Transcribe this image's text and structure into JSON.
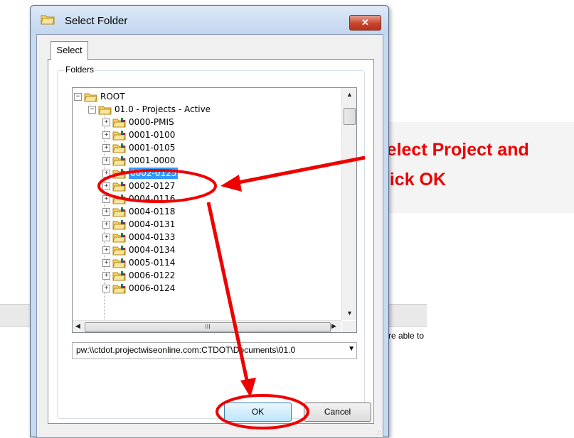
{
  "background": {
    "partial_text": "re able to"
  },
  "callout": {
    "text": "Select Project and\nclick OK",
    "color": "#ee0000"
  },
  "dialog": {
    "title": "Select Folder",
    "close_label": "✕",
    "tab_label": "Select",
    "group_label": "Folders",
    "tree": {
      "root_label": "ROOT",
      "active_label": "01.0 - Projects - Active",
      "items": [
        "0000-PMIS",
        "0001-0100",
        "0001-0105",
        "0001-0000",
        "0002-0125",
        "0002-0127",
        "0004-0116",
        "0004-0118",
        "0004-0131",
        "0004-0133",
        "0004-0134",
        "0005-0114",
        "0006-0122",
        "0006-0124"
      ],
      "selected": "0002-0125"
    },
    "path_value": "pw:\\\\ctdot.projectwiseonline.com:CTDOT\\Documents\\01.0",
    "ok_label": "OK",
    "cancel_label": "Cancel",
    "scroll_up": "▲",
    "scroll_down": "▼",
    "scroll_left": "◀",
    "scroll_right": "▶",
    "hthumb_grip": "III",
    "combo_arrow": "▼",
    "size_grip": ".::"
  },
  "colors": {
    "selection": "#3399ff",
    "annotation": "#ee0000"
  }
}
